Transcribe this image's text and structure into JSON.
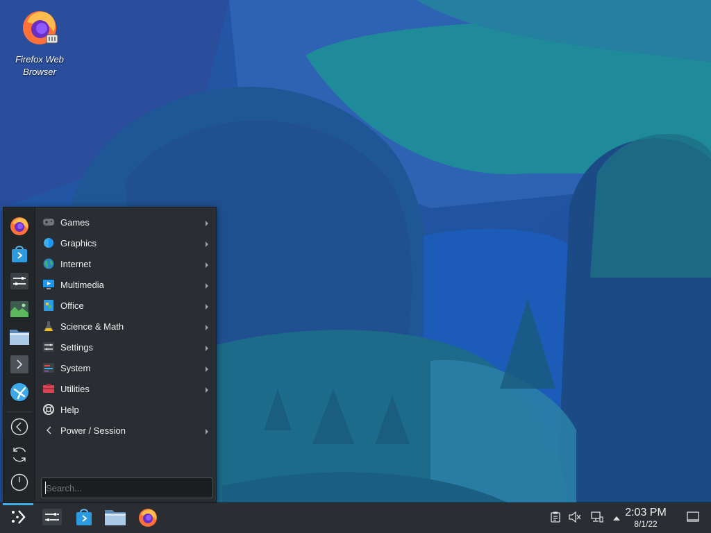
{
  "desktop": {
    "icons": [
      {
        "label_line1": "Firefox Web",
        "label_line2": "Browser",
        "icon": "firefox-icon"
      }
    ]
  },
  "launcher": {
    "favorites": [
      {
        "name": "Firefox",
        "icon": "firefox-icon"
      },
      {
        "name": "Discover",
        "icon": "discover-store-icon"
      },
      {
        "name": "System Settings",
        "icon": "settings-icon"
      },
      {
        "name": "Spectacle",
        "icon": "image-viewer-icon"
      },
      {
        "name": "Dolphin",
        "icon": "folder-icon"
      },
      {
        "name": "Konsole",
        "icon": "terminal-icon"
      },
      {
        "name": "KDE Connect",
        "icon": "kde-connect-icon"
      }
    ],
    "session_actions": [
      {
        "name": "Log Out",
        "icon": "logout-icon"
      },
      {
        "name": "Restart",
        "icon": "restart-icon"
      },
      {
        "name": "Shut Down",
        "icon": "power-icon"
      }
    ],
    "categories": [
      {
        "label": "Games",
        "icon": "games-icon",
        "has_submenu": true
      },
      {
        "label": "Graphics",
        "icon": "graphics-icon",
        "has_submenu": true
      },
      {
        "label": "Internet",
        "icon": "internet-icon",
        "has_submenu": true
      },
      {
        "label": "Multimedia",
        "icon": "multimedia-icon",
        "has_submenu": true
      },
      {
        "label": "Office",
        "icon": "office-icon",
        "has_submenu": true
      },
      {
        "label": "Science & Math",
        "icon": "science-icon",
        "has_submenu": true
      },
      {
        "label": "Settings",
        "icon": "settings-icon",
        "has_submenu": true
      },
      {
        "label": "System",
        "icon": "system-icon",
        "has_submenu": true
      },
      {
        "label": "Utilities",
        "icon": "utilities-icon",
        "has_submenu": true
      },
      {
        "label": "Help",
        "icon": "help-icon",
        "has_submenu": false
      },
      {
        "label": "Power / Session",
        "icon": "chevron-left-icon",
        "has_submenu": true
      }
    ],
    "search": {
      "placeholder": "Search...",
      "value": ""
    }
  },
  "taskbar": {
    "tasks": [
      {
        "name": "Application Launcher",
        "icon": "kde-launcher-icon",
        "active": true
      },
      {
        "name": "System Settings",
        "icon": "settings-icon"
      },
      {
        "name": "Discover",
        "icon": "discover-store-icon"
      },
      {
        "name": "Dolphin",
        "icon": "folder-icon"
      },
      {
        "name": "Firefox",
        "icon": "firefox-icon"
      }
    ],
    "tray": [
      {
        "name": "Clipboard",
        "icon": "clipboard-icon"
      },
      {
        "name": "Volume",
        "icon": "volume-muted-icon"
      },
      {
        "name": "Network",
        "icon": "network-icon"
      },
      {
        "name": "Show hidden icons",
        "icon": "chevron-up-icon"
      }
    ],
    "clock": {
      "time": "2:03 PM",
      "date": "8/1/22"
    },
    "show_desktop": {
      "icon": "show-desktop-icon"
    }
  },
  "colors": {
    "accent": "#3daee9",
    "panel": "#2a2e32",
    "menu": "#2a2e32",
    "text": "#eff0f1"
  }
}
